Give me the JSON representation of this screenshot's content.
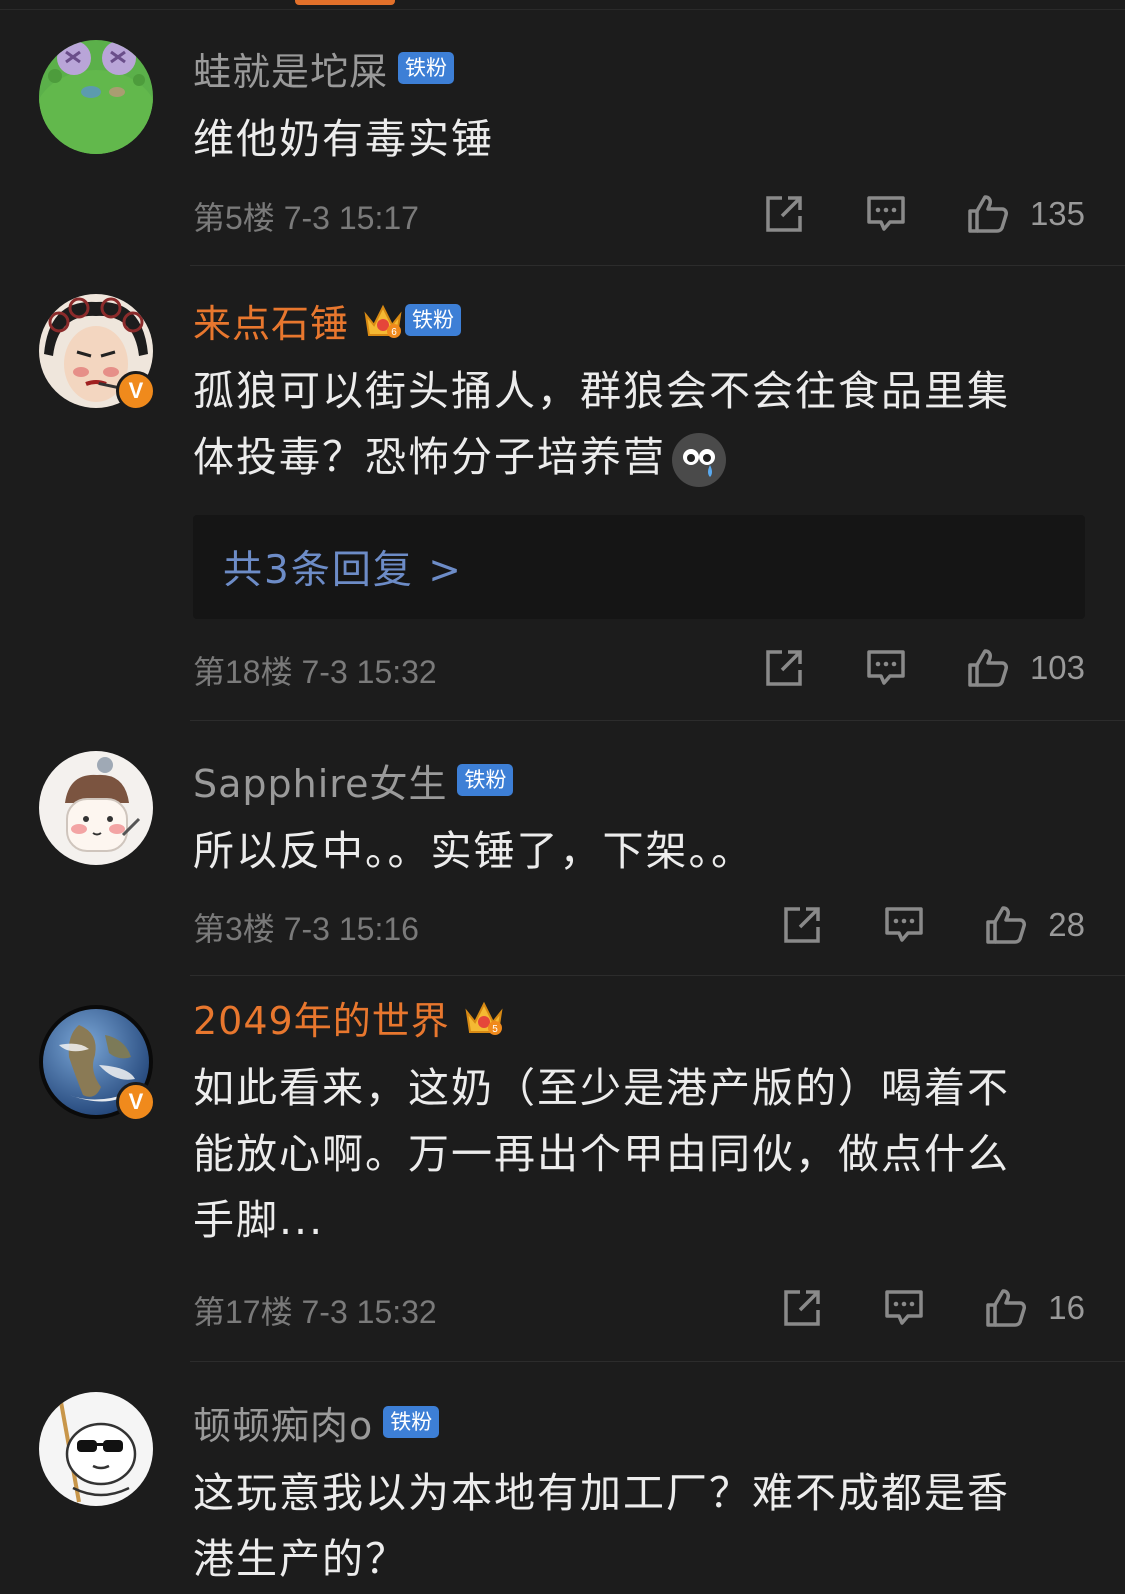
{
  "comments": [
    {
      "username": "蛙就是坨屎",
      "fan_badge": "铁粉",
      "text": "维他奶有毒实锤",
      "floor": "第5楼",
      "time": "7-3 15:17",
      "likes": "135",
      "avatar_icon": "frog-avatar"
    },
    {
      "username": "来点石锤",
      "fan_badge": "铁粉",
      "crown_level": "6",
      "verified": "V",
      "text_lines": [
        "孤狼可以街头捅人，群狼会不会往食品里集",
        "体投毒？恐怖分子培养营"
      ],
      "replies": "共3条回复 >",
      "floor": "第18楼",
      "time": "7-3 15:32",
      "likes": "103",
      "avatar_icon": "opera-face-avatar"
    },
    {
      "username": "Sapphire女生",
      "fan_badge": "铁粉",
      "text": "所以反中。。实锤了，下架。。",
      "floor": "第3楼",
      "time": "7-3 15:16",
      "likes": "28",
      "avatar_icon": "cartoon-girl-avatar"
    },
    {
      "username": "2049年的世界",
      "crown_level": "5",
      "verified": "V",
      "text_lines": [
        "如此看来，这奶（至少是港产版的）喝着不",
        "能放心啊。万一再出个甲由同伙，做点什么",
        "手脚..."
      ],
      "floor": "第17楼",
      "time": "7-3 15:32",
      "likes": "16",
      "avatar_icon": "earth-avatar"
    },
    {
      "username": "顿顿痴肉o",
      "fan_badge": "铁粉",
      "text_lines": [
        "这玩意我以为本地有加工厂？难不成都是香",
        "港生产的？"
      ],
      "avatar_icon": "sunglasses-cartoon-avatar"
    }
  ],
  "colors": {
    "background": "#1c1c1c",
    "vip_name": "#e8772e",
    "normal_name": "#9a9a9a",
    "fan_badge": "#3d7fd6",
    "reply_link": "#6d8cc7"
  },
  "icons": {
    "share": "share-icon",
    "comment": "comment-icon",
    "like": "thumbs-up-icon",
    "emoji": "crying-emoji-icon"
  }
}
